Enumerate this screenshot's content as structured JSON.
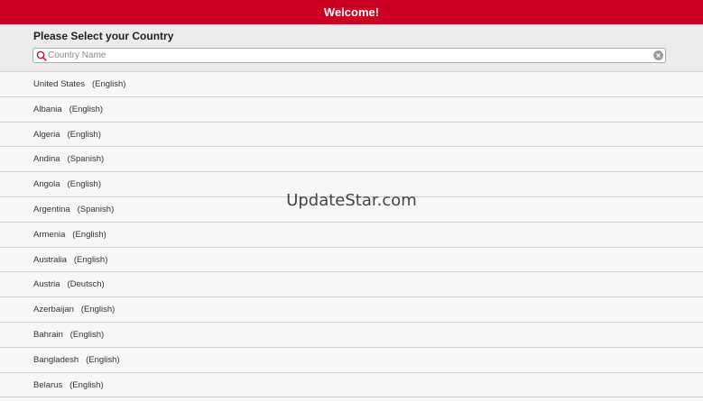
{
  "app": {
    "title": "Welcome!"
  },
  "header": {
    "prompt": "Please Select your Country",
    "search": {
      "placeholder": "Country Name",
      "value": ""
    }
  },
  "countries": [
    {
      "label": "United States   (English)"
    },
    {
      "label": "Albania   (English)"
    },
    {
      "label": "Algeria   (English)"
    },
    {
      "label": "Andina   (Spanish)"
    },
    {
      "label": "Angola   (English)"
    },
    {
      "label": "Argentina   (Spanish)"
    },
    {
      "label": "Armenia   (English)"
    },
    {
      "label": "Australia   (English)"
    },
    {
      "label": "Austria   (Deutsch)"
    },
    {
      "label": "Azerbaijan   (English)"
    },
    {
      "label": "Bahrain   (English)"
    },
    {
      "label": "Bangladesh   (English)"
    },
    {
      "label": "Belarus   (English)"
    }
  ],
  "watermark": "UpdateStar.com",
  "colors": {
    "title_bar": "#cc0022",
    "header_bg": "#ececec",
    "list_bg": "#f7f7f7"
  },
  "icons": {
    "search": "search-icon",
    "clear": "clear-icon"
  }
}
